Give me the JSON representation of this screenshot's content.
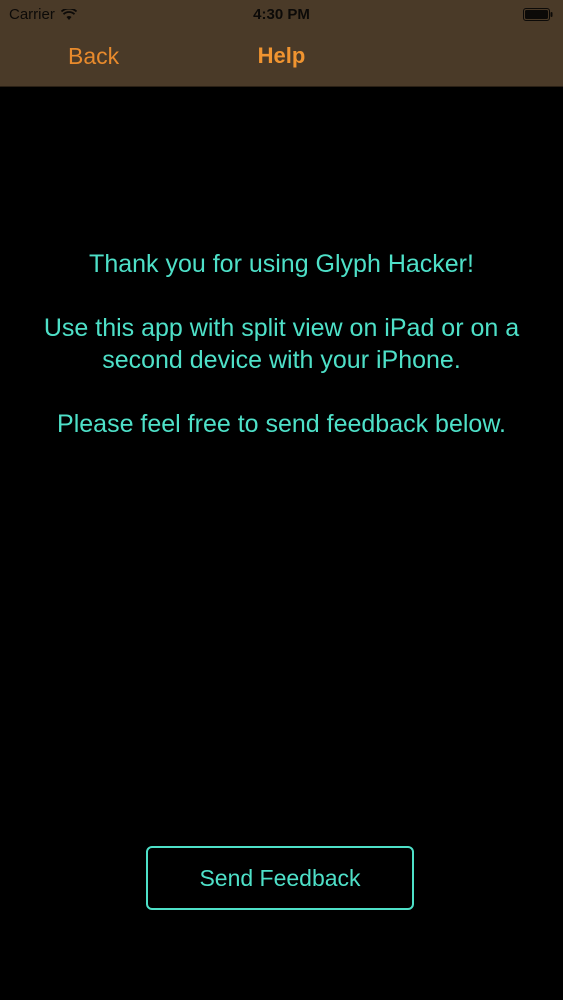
{
  "status_bar": {
    "carrier": "Carrier",
    "time": "4:30 PM"
  },
  "nav": {
    "back_label": "Back",
    "title": "Help"
  },
  "content": {
    "thank_you": "Thank you for using Glyph Hacker!",
    "usage": "Use this app with split view on iPad or on a second device with your iPhone.",
    "feedback_prompt": "Please feel free to send feedback below."
  },
  "actions": {
    "send_feedback_label": "Send Feedback"
  },
  "colors": {
    "nav_background": "#4a3a28",
    "accent_orange": "#f09430",
    "text_cyan": "#4ee0c8",
    "background": "#000000"
  }
}
